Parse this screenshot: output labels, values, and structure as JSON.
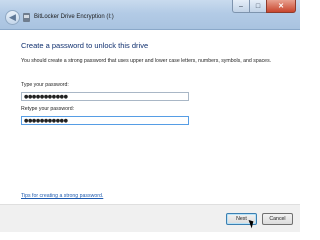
{
  "window": {
    "title": "BitLocker Drive Encryption (I:)",
    "controls": {
      "minimize": "–",
      "maximize": "□",
      "close": "✕"
    },
    "back_icon": "back-arrow-icon"
  },
  "main": {
    "heading": "Create a password to unlock this drive",
    "description": "You should create a strong password that uses upper and lower case letters, numbers, symbols, and spaces.",
    "password_label": "Type your password:",
    "password_value": "●●●●●●●●●●●",
    "retype_label": "Retype your password:",
    "retype_value": "●●●●●●●●●●●",
    "tips_link": "Tips for creating a strong password."
  },
  "footer": {
    "next_label": "Next",
    "cancel_label": "Cancel"
  },
  "colors": {
    "heading": "#10306f",
    "link": "#1e5bb0",
    "titlebar": "#b3cbe6",
    "close_button": "#c8452d"
  }
}
